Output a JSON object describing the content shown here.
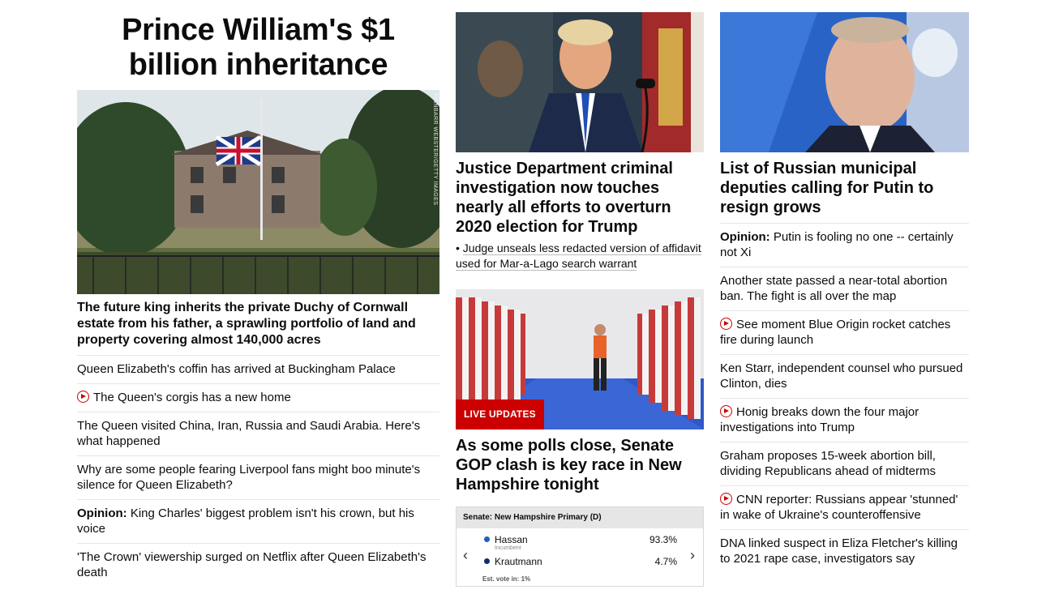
{
  "col1": {
    "title": "Prince William's $1 billion inheritance",
    "image_credit": "FINNBARR WEBSTER/GETTY IMAGES",
    "lead": "The future king inherits the private Duchy of Cornwall estate from his father, a sprawling portfolio of land and property covering almost 140,000 acres",
    "items": [
      {
        "text": "Queen Elizabeth's coffin has arrived at Buckingham Palace"
      },
      {
        "text": "The Queen's corgis has a new home"
      },
      {
        "text": "The Queen visited China, Iran, Russia and Saudi Arabia. Here's what happened"
      },
      {
        "text": "Why are some people fearing Liverpool fans might boo minute's silence for Queen Elizabeth?"
      },
      {
        "prefix": "Opinion:",
        "text": " King Charles' biggest problem isn't his crown, but his voice"
      },
      {
        "text": "'The Crown' viewership surged on Netflix after Queen Elizabeth's death"
      }
    ]
  },
  "col2": {
    "headline1": "Justice Department criminal investigation now touches nearly all efforts to overturn 2020 election for Trump",
    "sublink": "Judge unseals less redacted version of affidavit used for Mar-a-Lago search warrant",
    "live_badge": "LIVE UPDATES",
    "headline2": "As some polls close, Senate GOP clash is key race in New Hampshire tonight",
    "widget": {
      "title": "Senate: New Hampshire Primary (D)",
      "candidates": [
        {
          "name": "Hassan",
          "note": "Incumbent",
          "pct": "93.3%",
          "color": "#1f5fbd"
        },
        {
          "name": "Krautmann",
          "note": "",
          "pct": "4.7%",
          "color": "#0d2d6b"
        }
      ],
      "est_vote": "Est. vote in: 1%",
      "prev": "‹",
      "next": "›"
    }
  },
  "col3": {
    "headline": "List of Russian municipal deputies calling for Putin to resign grows",
    "items": [
      {
        "prefix": "Opinion:",
        "text": " Putin is fooling no one -- certainly not Xi"
      },
      {
        "text": "Another state passed a near-total abortion ban. The fight is all over the map"
      },
      {
        "text": "See moment Blue Origin rocket catches fire during launch"
      },
      {
        "text": "Ken Starr, independent counsel who pursued Clinton, dies"
      },
      {
        "text": "Honig breaks down the four major investigations into Trump"
      },
      {
        "text": "Graham proposes 15-week abortion bill, dividing Republicans ahead of midterms"
      },
      {
        "text": "CNN reporter: Russians appear 'stunned' in wake of Ukraine's counteroffensive"
      },
      {
        "text": "DNA linked suspect in Eliza Fletcher's killing to 2021 rape case, investigators say"
      }
    ]
  },
  "icons": {
    "video": "play-circle-icon"
  },
  "colors": {
    "live_red": "#cc0000",
    "link_text": "#0c0c0c",
    "divider": "#e6e6e6"
  }
}
